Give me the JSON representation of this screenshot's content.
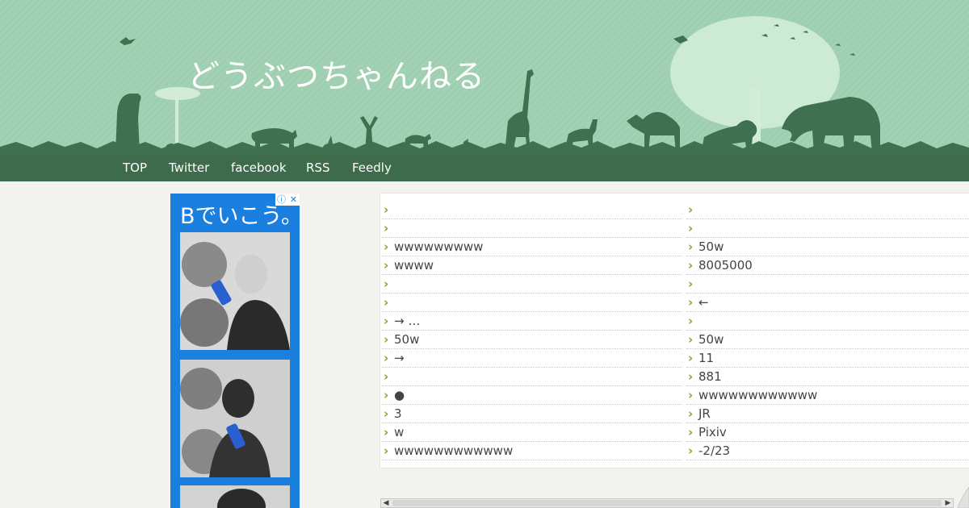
{
  "site": {
    "title": "どうぶつちゃんねる"
  },
  "nav": {
    "items": [
      {
        "label": "TOP"
      },
      {
        "label": "Twitter"
      },
      {
        "label": "facebook"
      },
      {
        "label": "RSS"
      },
      {
        "label": "Feedly"
      }
    ]
  },
  "ad": {
    "headline": "Bでいこう。",
    "info_icon": "ⓘ",
    "close_icon": "✕"
  },
  "articles": {
    "left": [
      {
        "title": ""
      },
      {
        "title": ""
      },
      {
        "title": "wwwwwwwww"
      },
      {
        "title": "wwww"
      },
      {
        "title": ""
      },
      {
        "title": ""
      },
      {
        "title": " → …"
      },
      {
        "title": "50w"
      },
      {
        "title": "→"
      },
      {
        "title": ""
      },
      {
        "title": "●"
      },
      {
        "title": "3"
      },
      {
        "title": "  w"
      },
      {
        "title": "wwwwwwwwwwww"
      }
    ],
    "right": [
      {
        "title": ""
      },
      {
        "title": ""
      },
      {
        "title": "50w"
      },
      {
        "title": "8005000"
      },
      {
        "title": ""
      },
      {
        "title": "←"
      },
      {
        "title": ""
      },
      {
        "title": "50w"
      },
      {
        "title": "11"
      },
      {
        "title": "881"
      },
      {
        "title": "wwwwwwwwwwww"
      },
      {
        "title": "JR"
      },
      {
        "title": "Pixiv"
      },
      {
        "title": "-2/23"
      }
    ]
  },
  "scrollbar": {
    "left_arrow": "◀",
    "right_arrow": "▶"
  },
  "colors": {
    "header_bg": "#9ecfb0",
    "silhouette": "#3f7050",
    "tree": "#d2ecd9",
    "nav_bg": "#3d6b4c",
    "bullet": "#7aa92b",
    "ad_bg": "#1b7fe0"
  }
}
